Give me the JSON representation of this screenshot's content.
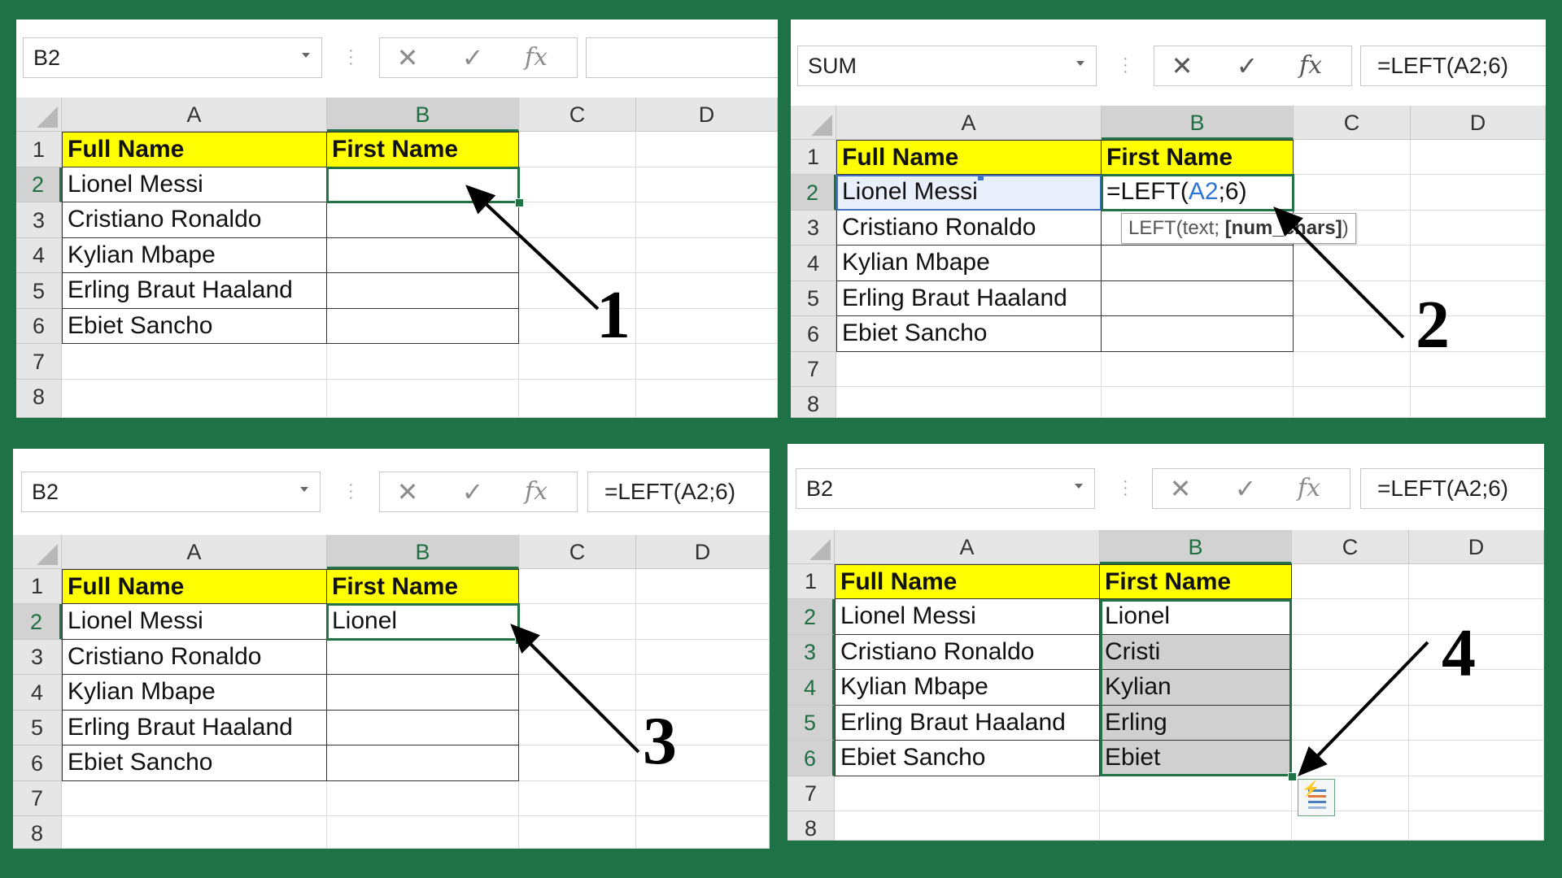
{
  "columns": [
    "A",
    "B",
    "C",
    "D"
  ],
  "rows": [
    "1",
    "2",
    "3",
    "4",
    "5",
    "6",
    "7",
    "8"
  ],
  "table": {
    "header_a": "Full Name",
    "header_b": "First Name",
    "names": [
      "Lionel Messi",
      "Cristiano Ronaldo",
      "Kylian Mbape",
      "Erling Braut Haaland",
      "Ebiet Sancho"
    ],
    "first_names": [
      "Lionel",
      "Cristi",
      "Kylian",
      "Erling",
      "Ebiet"
    ]
  },
  "panels": [
    {
      "name_box": "B2",
      "formula": "",
      "step": "1"
    },
    {
      "name_box": "SUM",
      "formula": "=LEFT(A2;6)",
      "step": "2",
      "editing_prefix": "=LEFT(",
      "editing_ref": "A2",
      "editing_suffix": ";6)",
      "tooltip_fn": "LEFT(text; ",
      "tooltip_arg": "[num_chars]",
      "tooltip_end": ")"
    },
    {
      "name_box": "B2",
      "formula": "=LEFT(A2;6)",
      "step": "3"
    },
    {
      "name_box": "B2",
      "formula": "=LEFT(A2;6)",
      "step": "4"
    }
  ],
  "toolbar": {
    "cancel_glyph": "✕",
    "enter_glyph": "✓",
    "fx_label": "fx"
  },
  "colors": {
    "background": "#1f7246",
    "header_fill": "#ffff00",
    "selection": "#217346",
    "ref_blue": "#2e75d6"
  },
  "icons": [
    "cancel-icon",
    "enter-icon",
    "insert-function-icon",
    "quick-analysis-icon",
    "dropdown-arrow-icon",
    "select-all-icon"
  ]
}
